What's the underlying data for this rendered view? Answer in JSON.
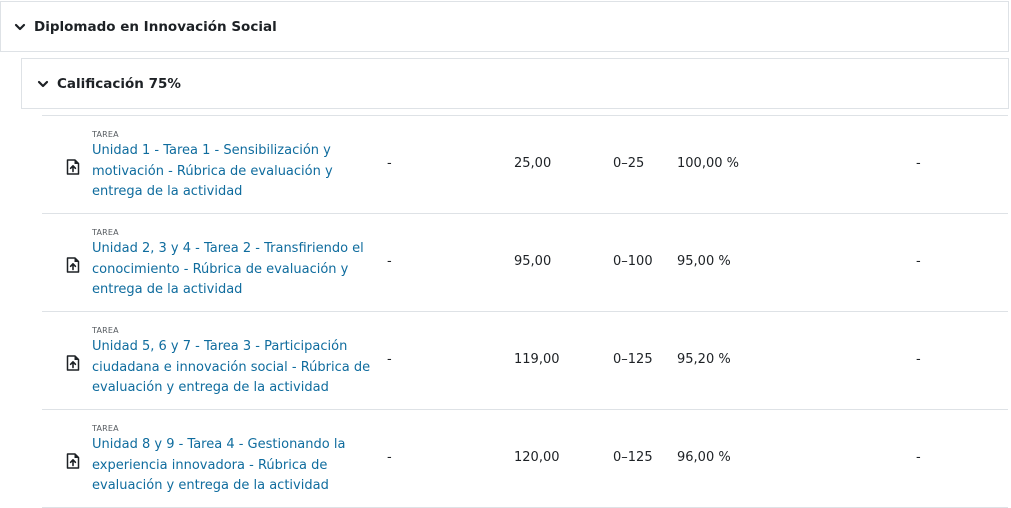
{
  "categories": [
    {
      "title": "Diplomado en Innovación Social"
    },
    {
      "title": "Calificación 75%"
    }
  ],
  "items": [
    {
      "type": "Tarea",
      "icon": "assignment-icon",
      "name": "Unidad 1 - Tarea 1 - Sensibilización y motivación - Rúbrica de evaluación y entrega de la actividad",
      "weight": "-",
      "grade": "25,00",
      "range": "0–25",
      "percentage": "100,00 %",
      "feedback": "-"
    },
    {
      "type": "Tarea",
      "icon": "assignment-icon",
      "name": "Unidad 2, 3 y 4 - Tarea 2 - Transfiriendo el conocimiento - Rúbrica de evaluación y entrega de la actividad",
      "weight": "-",
      "grade": "95,00",
      "range": "0–100",
      "percentage": "95,00 %",
      "feedback": "-"
    },
    {
      "type": "Tarea",
      "icon": "assignment-icon",
      "name": "Unidad 5, 6 y 7 - Tarea 3 - Participación ciudadana e innovación social - Rúbrica de evaluación y entrega de la actividad",
      "weight": "-",
      "grade": "119,00",
      "range": "0–125",
      "percentage": "95,20 %",
      "feedback": "-"
    },
    {
      "type": "Tarea",
      "icon": "assignment-icon",
      "name": "Unidad 8 y 9 - Tarea 4 - Gestionando la experiencia innovadora - Rúbrica de evaluación y entrega de la actividad",
      "weight": "-",
      "grade": "120,00",
      "range": "0–125",
      "percentage": "96,00 %",
      "feedback": "-"
    }
  ],
  "colors": {
    "link": "#0f6c9e",
    "border": "#dee2e6",
    "text": "#1d2125"
  }
}
